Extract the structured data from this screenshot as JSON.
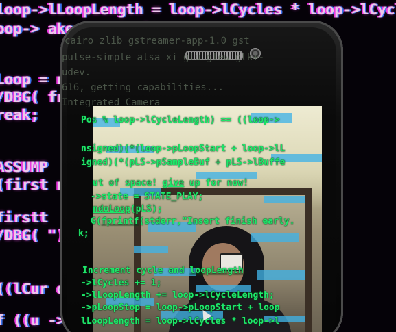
{
  "background_code": [
    "loop->lLoopLength = loop->lCycles * loop->lCycles",
    "oop->    ake sun                          p->lLo",
    "Loop =                                    nextSta",
    "/DBG(                                      from ",
    "reak;",
    "ASSUMP",
    "(first                                     ngth =",
    "firstt",
    "/DBG(                                     \");",
    "((lCur                                    op->lLo",
    "f ((u                                     ->lLoop"
  ],
  "terminal_text": [
    "   cairo zlib gstreamer-app-1.0 gst",
    "pulse-simple alsa xi glu glew gtk+-",
    "  udev.",
    "616, getting capabilities...",
    "   Integrated Camera"
  ],
  "screen_code": [
    {
      "text": "Pos % loop->lCycleLength) == ((loop->",
      "u": ""
    },
    {
      "text": "nsigned)(*(loop->pLoopStart + loop->lL",
      "u": ""
    },
    {
      "text": "igned)(*(pLS->pSampleBuf + pLS->lBuffe",
      "u": ""
    },
    {
      "text": "ut of space! ",
      "u": "give",
      "rest": " up for now!"
    },
    {
      "text": "->state = STATE_PLAY;",
      "u": ""
    },
    {
      "text": "",
      "u": "ndoLoop",
      "rest": "(pLS);"
    },
    {
      "text": "G(",
      "u": "fprintf",
      "rest": "(stderr,\"Insert finish early. "
    },
    {
      "text": "k;",
      "u": ""
    },
    {
      "text": "Increment cycle and ",
      "u": "loopLength",
      "rest": ""
    },
    {
      "text": "->lCycles += 1;",
      "u": ""
    },
    {
      "text": "->lLoopLength += loop->lCycleLength;",
      "u": ""
    },
    {
      "text": "->pLoopStop = loop->pLoopStart + loop",
      "u": ""
    },
    {
      "text": "lLoopLength = loop->lCycles * loop->l",
      "u": ""
    }
  ],
  "colors": {
    "background": "#050208",
    "code_green": "#1ee86a",
    "overlay_blue": "#40b2e6",
    "glitch_magenta": "#ff3cf0"
  },
  "icons": [
    "speaker-grille",
    "front-camera",
    "mouse-cursor"
  ]
}
